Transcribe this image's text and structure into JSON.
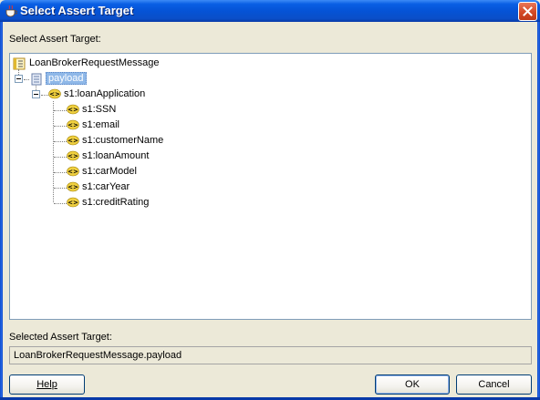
{
  "window": {
    "title": "Select Assert Target"
  },
  "tree_label": "Select Assert Target:",
  "tree": {
    "root": "LoanBrokerRequestMessage",
    "part": "payload",
    "element": "s1:loanApplication",
    "children": [
      "s1:SSN",
      "s1:email",
      "s1:customerName",
      "s1:loanAmount",
      "s1:carModel",
      "s1:carYear",
      "s1:creditRating"
    ]
  },
  "selected_label": "Selected Assert Target:",
  "selected_value": "LoanBrokerRequestMessage.payload",
  "buttons": {
    "help": "Help",
    "ok": "OK",
    "cancel": "Cancel"
  },
  "colors": {
    "titlebar": "#0553d6",
    "selection": "#8fb8e8",
    "element_icon": "#e8c000"
  },
  "icons": {
    "title": "coffee-cup-icon",
    "root": "message-icon",
    "part": "part-icon",
    "element": "xml-element-icon"
  }
}
